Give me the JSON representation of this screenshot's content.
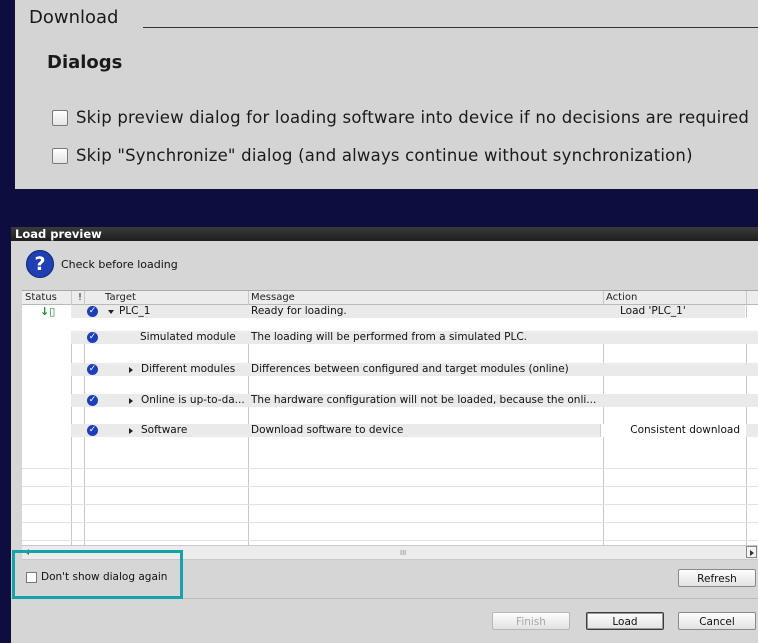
{
  "settings": {
    "section_title": "Download",
    "subsection_title": "Dialogs",
    "options": [
      "Skip preview dialog for loading software into device if no decisions are required",
      "Skip \"Synchronize\" dialog (and always continue without synchronization)"
    ]
  },
  "dialog": {
    "title": "Load preview",
    "help_icon": "question-icon",
    "check_text": "Check before loading",
    "columns": [
      "Status",
      "!",
      "Target",
      "Message",
      "Action"
    ],
    "rows": [
      {
        "status_icon": "download-status-icon",
        "target": "PLC_1",
        "message": "Ready for loading.",
        "action": "Load 'PLC_1'"
      },
      {
        "target": "Simulated module",
        "message": "The loading will be performed from a simulated PLC.",
        "action": ""
      },
      {
        "target": "Different modules",
        "message": "Differences between configured and target modules (online)",
        "action": ""
      },
      {
        "target": "Online is up-to-da...",
        "message": "The hardware configuration will not be loaded, because the onli...",
        "action": ""
      },
      {
        "target": "Software",
        "message": "Download software to device",
        "action": "Consistent download"
      }
    ],
    "scroll_grip": "III",
    "dont_show_label": "Don't show dialog again",
    "buttons": {
      "refresh": "Refresh",
      "finish": "Finish",
      "load": "Load",
      "cancel": "Cancel"
    }
  },
  "colors": {
    "background": "#0d0d3f",
    "accent_check": "#1d3fb9",
    "highlight": "#14a3a6"
  }
}
